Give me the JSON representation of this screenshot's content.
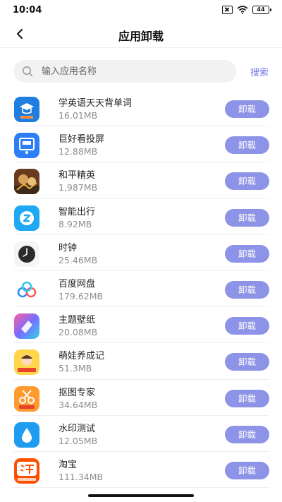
{
  "status_bar": {
    "time": "10:04",
    "battery": "44"
  },
  "nav": {
    "title": "应用卸载"
  },
  "search": {
    "placeholder": "输入应用名称",
    "button_label": "搜索"
  },
  "apps": [
    {
      "name": "学英语天天背单词",
      "size": "16.01MB",
      "button": "卸载",
      "icon": "english-study-app-icon"
    },
    {
      "name": "巨好看投屏",
      "size": "12.88MB",
      "button": "卸载",
      "icon": "screen-cast-app-icon"
    },
    {
      "name": "和平精英",
      "size": "1,987MB",
      "button": "卸载",
      "icon": "game-app-icon"
    },
    {
      "name": "智能出行",
      "size": "8.92MB",
      "button": "卸载",
      "icon": "travel-app-icon"
    },
    {
      "name": "时钟",
      "size": "25.46MB",
      "button": "卸载",
      "icon": "clock-app-icon"
    },
    {
      "name": "百度网盘",
      "size": "179.62MB",
      "button": "卸载",
      "icon": "cloud-drive-app-icon"
    },
    {
      "name": "主题壁纸",
      "size": "20.08MB",
      "button": "卸载",
      "icon": "theme-wallpaper-app-icon"
    },
    {
      "name": "萌娃养成记",
      "size": "51.3MB",
      "button": "卸载",
      "icon": "baby-game-app-icon"
    },
    {
      "name": "抠图专家",
      "size": "34.64MB",
      "button": "卸载",
      "icon": "cutout-app-icon"
    },
    {
      "name": "水印测试",
      "size": "12.05MB",
      "button": "卸载",
      "icon": "watermark-app-icon"
    },
    {
      "name": "淘宝",
      "size": "111.34MB",
      "button": "卸载",
      "icon": "taobao-app-icon"
    }
  ],
  "colors": {
    "accent": "#8d93e6",
    "search_link": "#6b74e6"
  }
}
